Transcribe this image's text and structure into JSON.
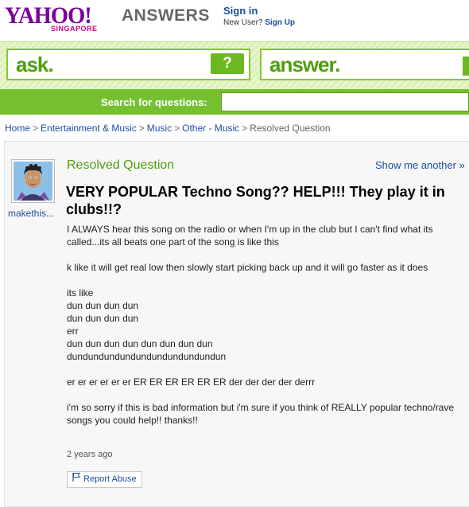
{
  "header": {
    "logo_text": "YAHOO!",
    "logo_region": "SINGAPORE",
    "product": "ANSWERS",
    "sign_in": "Sign in",
    "new_user_text": "New User?",
    "sign_up": "Sign Up"
  },
  "band": {
    "ask_label": "ask.",
    "ask_button": "?",
    "answer_label": "answer."
  },
  "search": {
    "label": "Search for questions:",
    "value": ""
  },
  "breadcrumb": [
    "Home",
    "Entertainment & Music",
    "Music",
    "Other - Music",
    "Resolved Question"
  ],
  "breadcrumb_separator": ">",
  "question": {
    "status": "Resolved Question",
    "show_another": "Show me another »",
    "username": "makethis...",
    "title": "VERY POPULAR Techno Song?? HELP!!! They play it in clubs!!?",
    "body_paragraphs": [
      "I ALWAYS hear this song on the radio or when I'm up in the club but I can't find what its called...its all beats one part of the song is like this",
      "k like it will get real low then slowly start picking back up and it will go faster as it does"
    ],
    "body_lines": [
      "its like",
      "dun dun dun dun",
      "dun dun dun dun",
      "err",
      "dun dun dun dun dun dun dun dun",
      "dundundundundundundundundundun"
    ],
    "body_closing": [
      "er er er er er er ER ER ER ER ER ER der der der der derrr",
      "i'm so sorry if this is bad information but i'm sure if you think of REALLY popular techno/rave songs you could help!! thanks!!"
    ],
    "timestamp": "2 years ago",
    "report_abuse": "Report Abuse"
  },
  "colors": {
    "yahoo_purple": "#7b0099",
    "answers_green": "#76c030",
    "link_blue": "#1a4fa0"
  }
}
